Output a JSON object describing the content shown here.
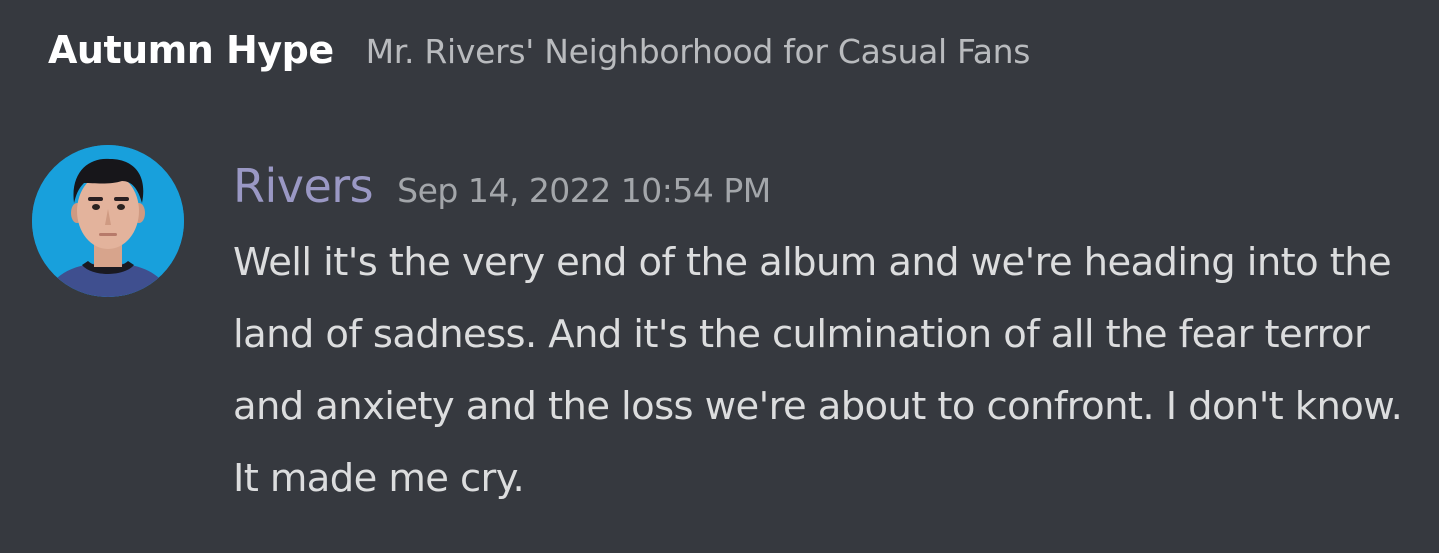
{
  "header": {
    "channel_name": "Autumn Hype",
    "server_name": "Mr. Rivers' Neighborhood for Casual Fans"
  },
  "message": {
    "author": "Rivers",
    "timestamp": "Sep 14, 2022 10:54 PM",
    "content": "Well it's the very end of the album and we're heading into the land of sadness. And it's the culmination of all the fear terror and anxiety and the loss we're about to confront. I don't know. It made me cry.",
    "author_color": "#9a98c4"
  },
  "colors": {
    "background": "#36393f",
    "avatar_background": "#18a0dc"
  }
}
